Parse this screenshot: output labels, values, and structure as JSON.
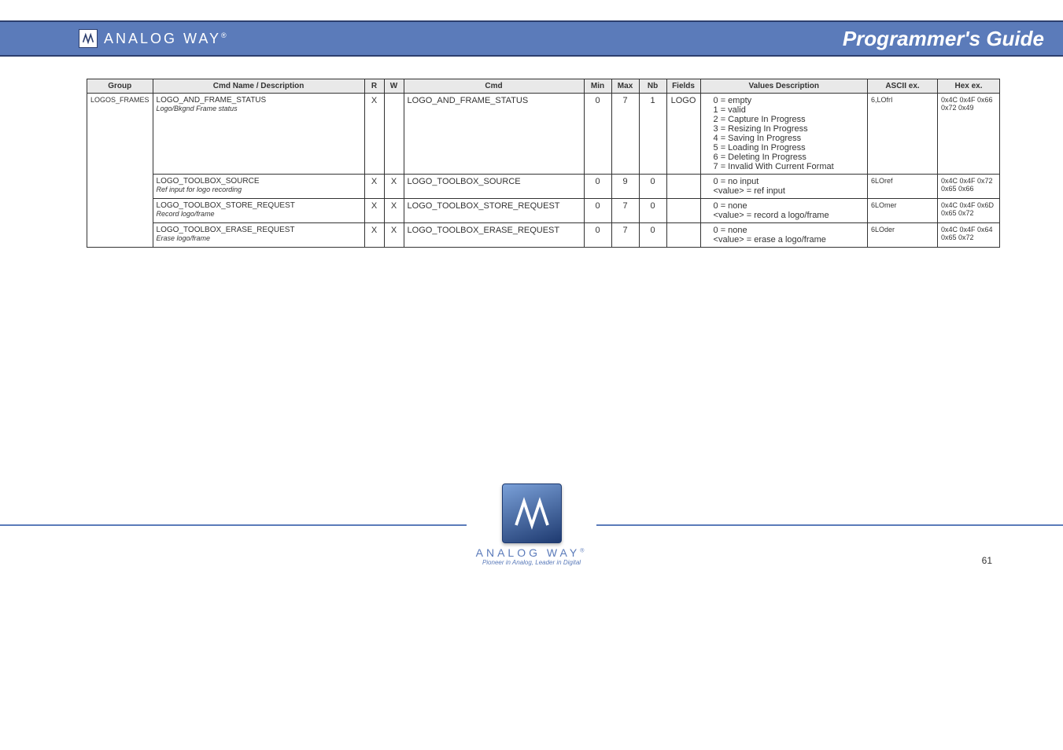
{
  "header": {
    "brand": "ANALOG WAY",
    "brand_suffix": "®",
    "title": "Programmer's Guide"
  },
  "table": {
    "headers": {
      "group": "Group",
      "name": "Cmd Name / Description",
      "r": "R",
      "w": "W",
      "cmd": "Cmd",
      "min": "Min",
      "max": "Max",
      "nb": "Nb",
      "fields": "Fields",
      "desc": "Values Description",
      "ascii": "ASCII ex.",
      "hex": "Hex ex."
    },
    "rows": [
      {
        "group": "LOGOS_FRAMES",
        "group_rowspan": 4,
        "name": "LOGO_AND_FRAME_STATUS",
        "name_sub": "Logo/Bkgnd Frame status",
        "r": "X",
        "w": "",
        "cmd": "LOGO_AND_FRAME_STATUS",
        "min": "0",
        "max": "7",
        "nb": "1",
        "fields": "LOGO",
        "desc_lines": [
          "0 = empty",
          "1 = valid",
          "2 = Capture In Progress",
          "3 = Resizing In Progress",
          "4 = Saving In Progress",
          "5 = Loading In Progress",
          "6 = Deleting In Progress",
          "7 = Invalid With Current Format"
        ],
        "ascii": "6,LOfrI",
        "hex": "0x4C 0x4F 0x66 0x72 0x49"
      },
      {
        "name": "LOGO_TOOLBOX_SOURCE",
        "name_sub": "Ref input for logo recording",
        "r": "X",
        "w": "X",
        "cmd": "LOGO_TOOLBOX_SOURCE",
        "min": "0",
        "max": "9",
        "nb": "0",
        "fields": "",
        "desc_lines": [
          "0 = no input",
          "<value> = ref input"
        ],
        "ascii": "6LOref",
        "hex": "0x4C 0x4F 0x72 0x65 0x66"
      },
      {
        "name": "LOGO_TOOLBOX_STORE_REQUEST",
        "name_sub": "Record logo/frame",
        "r": "X",
        "w": "X",
        "cmd": "LOGO_TOOLBOX_STORE_REQUEST",
        "min": "0",
        "max": "7",
        "nb": "0",
        "fields": "",
        "desc_lines": [
          "0 = none",
          "<value> = record a logo/frame"
        ],
        "ascii": "6LOmer",
        "hex": "0x4C 0x4F 0x6D 0x65 0x72"
      },
      {
        "name": "LOGO_TOOLBOX_ERASE_REQUEST",
        "name_sub": "Erase logo/frame",
        "r": "X",
        "w": "X",
        "cmd": "LOGO_TOOLBOX_ERASE_REQUEST",
        "min": "0",
        "max": "7",
        "nb": "0",
        "fields": "",
        "desc_lines": [
          "0 = none",
          "<value> = erase a logo/frame"
        ],
        "ascii": "6LOder",
        "hex": "0x4C 0x4F 0x64 0x65 0x72"
      }
    ]
  },
  "footer": {
    "brand": "ANALOG WAY",
    "brand_suffix": "®",
    "tagline": "Pioneer in Analog, Leader in Digital",
    "page": "61"
  }
}
